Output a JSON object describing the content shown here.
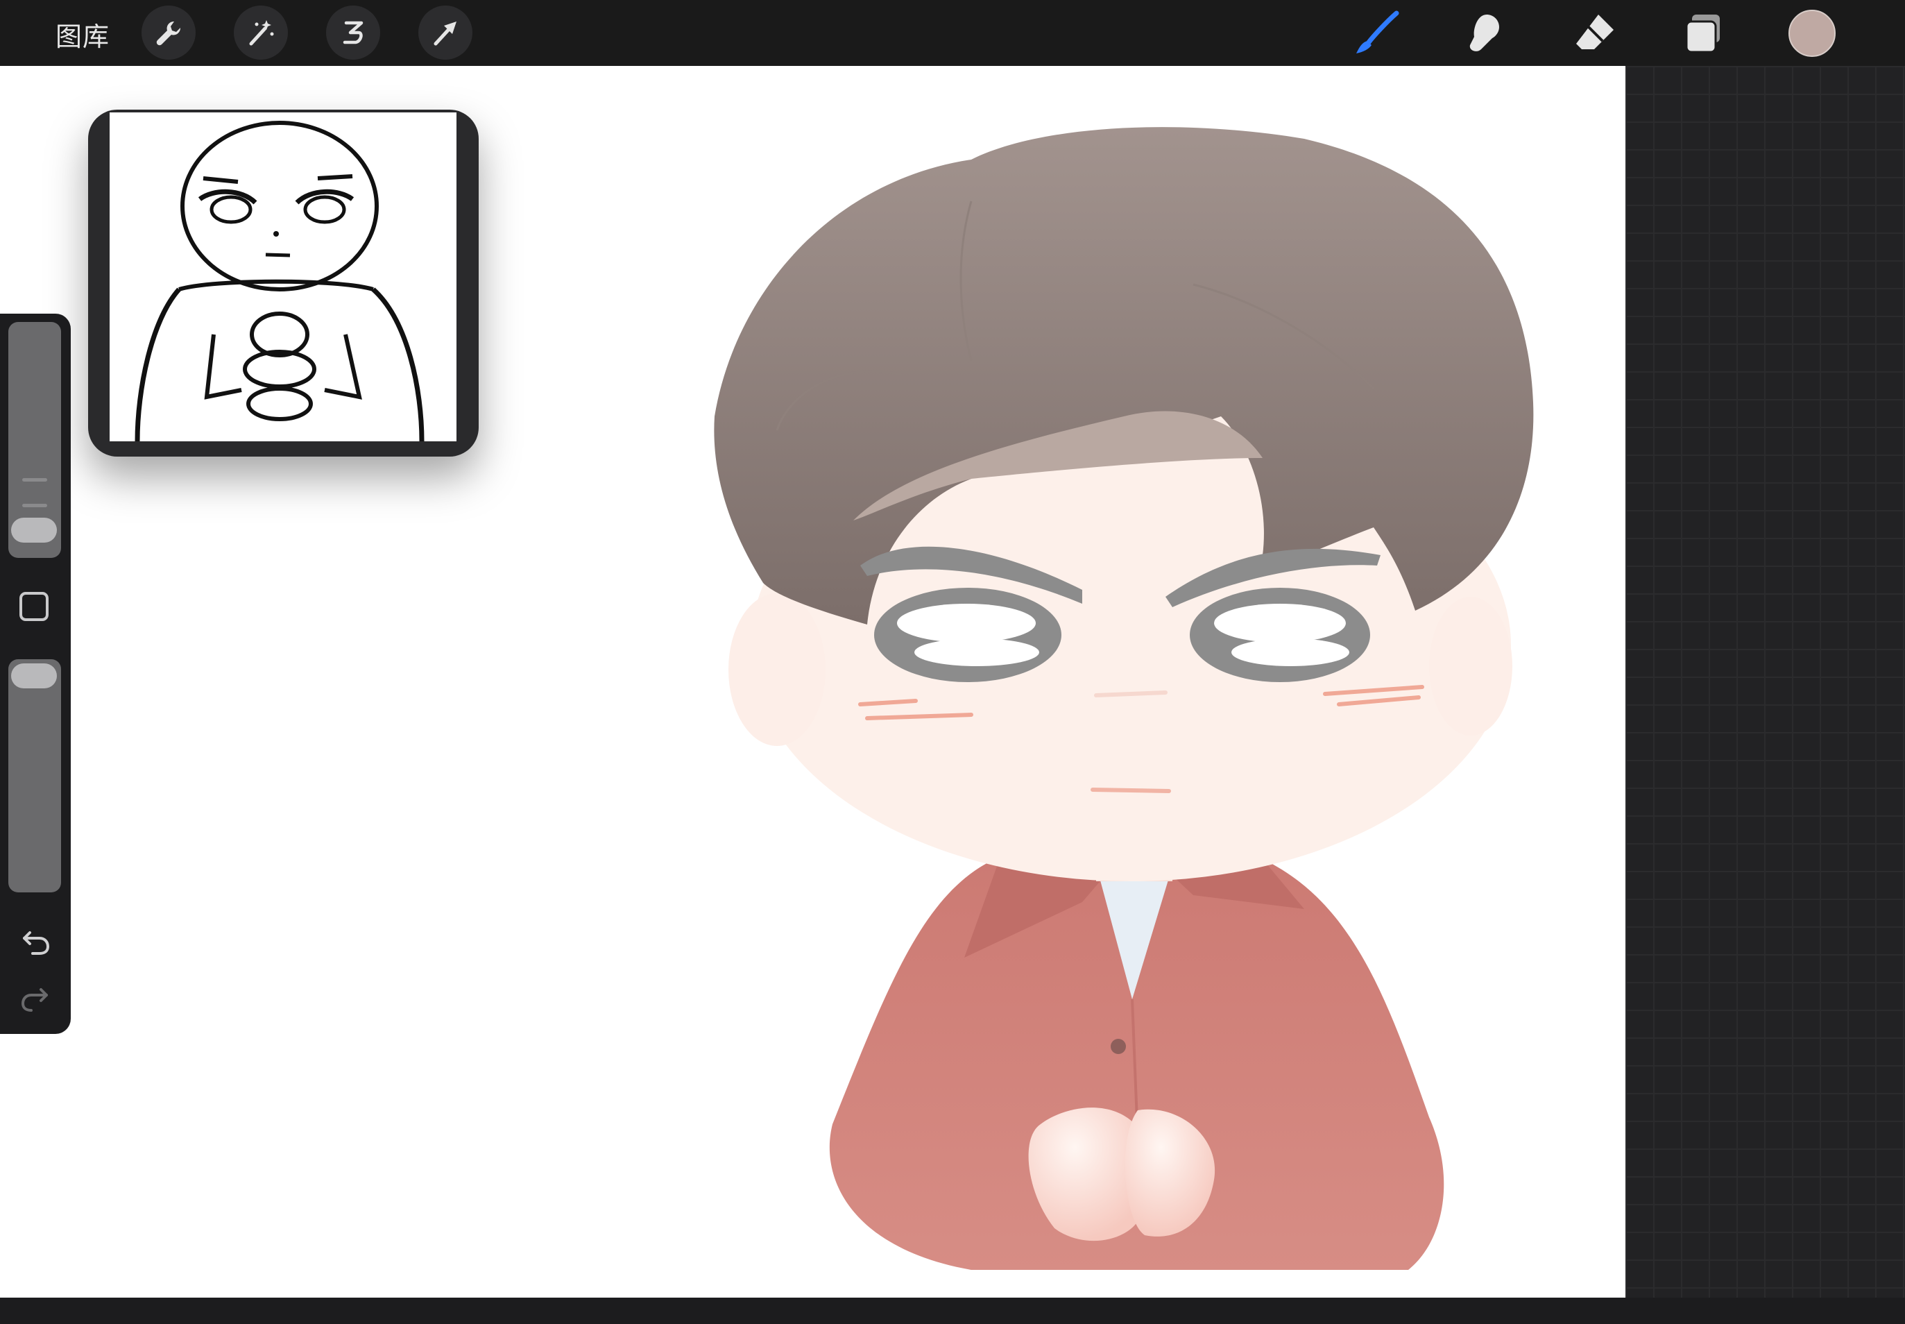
{
  "toolbar": {
    "gallery_label": "图库",
    "left_tools": [
      {
        "name": "actions",
        "icon": "wrench-icon"
      },
      {
        "name": "adjustments",
        "icon": "magic-wand-icon"
      },
      {
        "name": "selection",
        "icon": "selection-s-icon"
      },
      {
        "name": "transform",
        "icon": "arrow-cursor-icon"
      }
    ],
    "right_tools": [
      {
        "name": "brush",
        "icon": "brush-icon",
        "active": true,
        "color": "#2f7bff"
      },
      {
        "name": "smudge",
        "icon": "smudge-icon"
      },
      {
        "name": "eraser",
        "icon": "eraser-icon"
      },
      {
        "name": "layers",
        "icon": "layers-icon"
      }
    ],
    "current_color": "#bfa9a3"
  },
  "reference": {
    "window": "reference-image"
  },
  "sidebar": {
    "brush_size": 0.1,
    "opacity": 1.0,
    "undo_icon": "undo-icon",
    "redo_icon": "redo-icon"
  },
  "colors": {
    "hair": "#8a7b77",
    "skin": "#fdf0ea",
    "shirt": "#d4827a",
    "eyes": "#8c8c8c"
  }
}
